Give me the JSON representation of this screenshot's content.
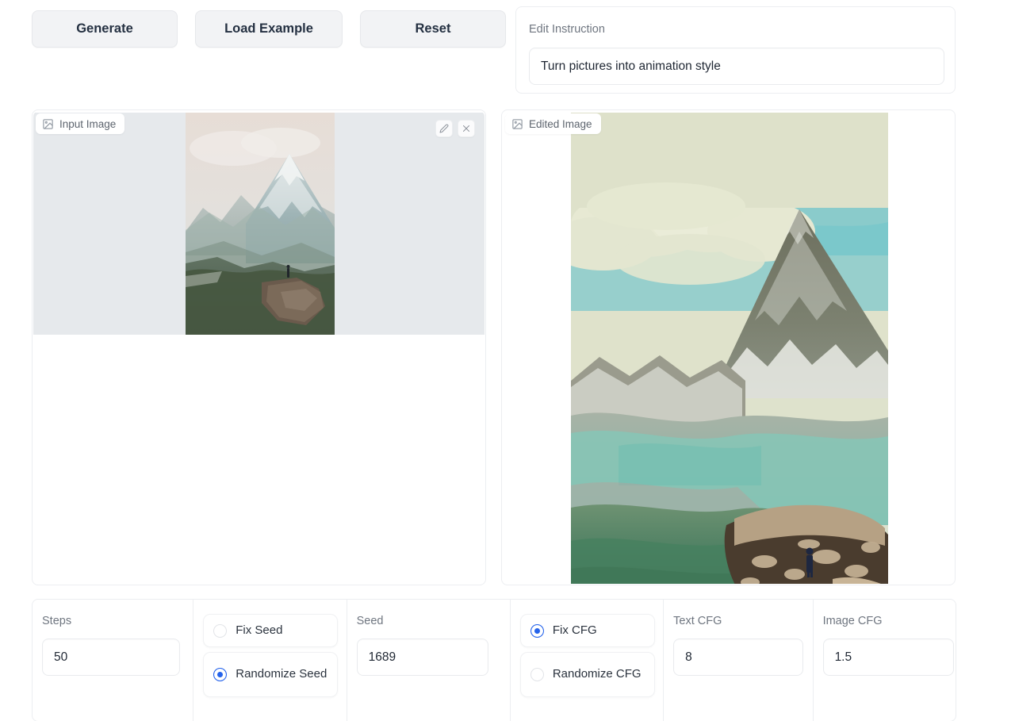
{
  "toolbar": {
    "generate_label": "Generate",
    "load_example_label": "Load Example",
    "reset_label": "Reset"
  },
  "instruction": {
    "label": "Edit Instruction",
    "value": "Turn pictures into animation style",
    "placeholder": "Turn pictures into animation style"
  },
  "panels": {
    "input": {
      "tag": "Input Image",
      "tag_icon": "image-icon",
      "tools": [
        {
          "name": "edit-icon",
          "title": "Edit"
        },
        {
          "name": "close-icon",
          "title": "Clear"
        }
      ],
      "content_description": "Photograph of a snow covered Matterhorn peak with a person standing on a rocky cliff above a pine forest"
    },
    "edited": {
      "tag": "Edited Image",
      "tag_icon": "image-icon",
      "content_description": "Animation styled illustration of the same mountain scene with teal sky, cream clouds and a person on a cliff"
    }
  },
  "controls": {
    "steps": {
      "label": "Steps",
      "value": "50"
    },
    "seed_mode": {
      "options": [
        {
          "label": "Fix Seed",
          "selected": false
        },
        {
          "label": "Randomize Seed",
          "selected": true
        }
      ]
    },
    "seed": {
      "label": "Seed",
      "value": "1689"
    },
    "cfg_mode": {
      "options": [
        {
          "label": "Fix CFG",
          "selected": true
        },
        {
          "label": "Randomize CFG",
          "selected": false
        }
      ]
    },
    "text_cfg": {
      "label": "Text CFG",
      "value": "8"
    },
    "image_cfg": {
      "label": "Image CFG",
      "value": "1.5"
    }
  },
  "colors": {
    "accent": "#2563eb",
    "button_bg": "#f2f3f5",
    "border": "#eceef1",
    "letterbox": "#e6e9ec",
    "text": "#243041",
    "muted_text": "#6f7680"
  }
}
